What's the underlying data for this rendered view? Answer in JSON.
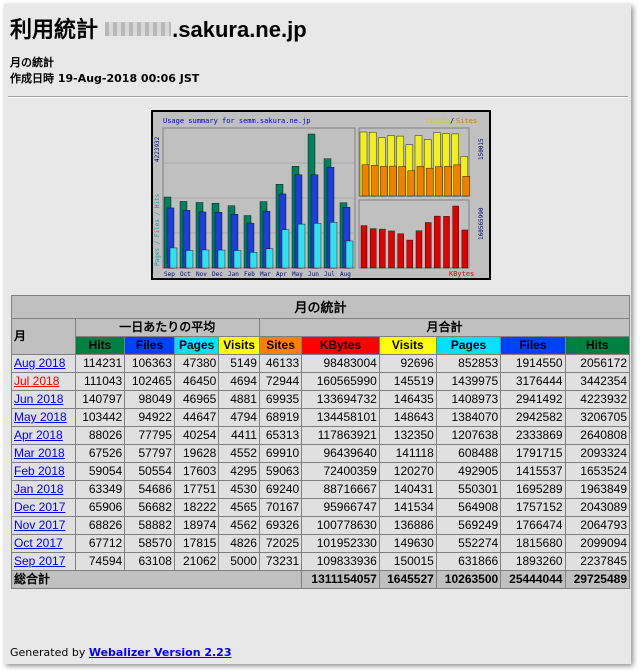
{
  "page": {
    "title_prefix": "利用統計",
    "title_suffix": ".sakura.ne.jp",
    "subtitle": "月の統計",
    "generated_line": "作成日時 19-Aug-2018 00:06 JST"
  },
  "chart_data": {
    "type": "bar",
    "title": "Usage summary for semm.sakura.ne.jp",
    "categories": [
      "Sep",
      "Oct",
      "Nov",
      "Dec",
      "Jan",
      "Feb",
      "Mar",
      "Apr",
      "May",
      "Jun",
      "Jul",
      "Aug"
    ],
    "left_axis_label": "Pages / Files / Hits",
    "left_axis_max_label": "4223932",
    "right_top_legend": [
      "Visits",
      "/",
      "Sites"
    ],
    "right_top_max_label": "150015",
    "right_bottom_legend": "KBytes",
    "right_bottom_max_label": "160565990",
    "series": [
      {
        "name": "Hits",
        "color": "#00805a",
        "values": [
          2237845,
          2099094,
          2064793,
          2043089,
          1963849,
          1653524,
          2093324,
          2640808,
          3206705,
          4223932,
          3442354,
          2056172
        ]
      },
      {
        "name": "Files",
        "color": "#1e3ed8",
        "values": [
          1893260,
          1815680,
          1766474,
          1757152,
          1695289,
          1415537,
          1791715,
          2333869,
          2942582,
          2941492,
          3176444,
          1914550
        ]
      },
      {
        "name": "Pages",
        "color": "#30e0f0",
        "values": [
          631866,
          552274,
          569249,
          564908,
          550301,
          492905,
          608488,
          1207638,
          1384070,
          1408973,
          1439975,
          852853
        ]
      },
      {
        "name": "Visits",
        "color": "#f0f020",
        "values": [
          150015,
          149630,
          136886,
          141534,
          140431,
          120270,
          141118,
          132350,
          148643,
          146435,
          145519,
          92696
        ]
      },
      {
        "name": "Sites",
        "color": "#f08000",
        "values": [
          73231,
          72025,
          69326,
          70167,
          69240,
          59063,
          69910,
          65313,
          68919,
          69935,
          72944,
          46133
        ]
      },
      {
        "name": "KBytes",
        "color": "#e00000",
        "values": [
          109833936,
          101952330,
          100778630,
          95966747,
          88716667,
          72400359,
          96439640,
          117863921,
          134458101,
          133694732,
          160565990,
          98483004
        ]
      }
    ]
  },
  "table": {
    "caption": "月の統計",
    "month_header": "月",
    "daily_avg_header": "一日あたりの平均",
    "monthly_total_header": "月合計",
    "daily_cols": [
      {
        "label": "Hits",
        "color": "#008040",
        "text": "#000000"
      },
      {
        "label": "Files",
        "color": "#0040ff",
        "text": "#000000"
      },
      {
        "label": "Pages",
        "color": "#00e0ff",
        "text": "#000000"
      },
      {
        "label": "Visits",
        "color": "#ffff00",
        "text": "#000000"
      }
    ],
    "total_cols": [
      {
        "label": "Sites",
        "color": "#ff8000",
        "text": "#000000"
      },
      {
        "label": "KBytes",
        "color": "#ff0000",
        "text": "#000000"
      },
      {
        "label": "Visits",
        "color": "#ffff00",
        "text": "#000000"
      },
      {
        "label": "Pages",
        "color": "#00e0ff",
        "text": "#000000"
      },
      {
        "label": "Files",
        "color": "#0040ff",
        "text": "#000000"
      },
      {
        "label": "Hits",
        "color": "#008040",
        "text": "#000000"
      }
    ],
    "rows": [
      {
        "month": "Aug 2018",
        "current": false,
        "vals": [
          "114231",
          "106363",
          "47380",
          "5149",
          "46133",
          "98483004",
          "92696",
          "852853",
          "1914550",
          "2056172"
        ]
      },
      {
        "month": "Jul 2018",
        "current": true,
        "vals": [
          "111043",
          "102465",
          "46450",
          "4694",
          "72944",
          "160565990",
          "145519",
          "1439975",
          "3176444",
          "3442354"
        ]
      },
      {
        "month": "Jun 2018",
        "current": false,
        "vals": [
          "140797",
          "98049",
          "46965",
          "4881",
          "69935",
          "133694732",
          "146435",
          "1408973",
          "2941492",
          "4223932"
        ]
      },
      {
        "month": "May 2018",
        "current": false,
        "vals": [
          "103442",
          "94922",
          "44647",
          "4794",
          "68919",
          "134458101",
          "148643",
          "1384070",
          "2942582",
          "3206705"
        ]
      },
      {
        "month": "Apr 2018",
        "current": false,
        "vals": [
          "88026",
          "77795",
          "40254",
          "4411",
          "65313",
          "117863921",
          "132350",
          "1207638",
          "2333869",
          "2640808"
        ]
      },
      {
        "month": "Mar 2018",
        "current": false,
        "vals": [
          "67526",
          "57797",
          "19628",
          "4552",
          "69910",
          "96439640",
          "141118",
          "608488",
          "1791715",
          "2093324"
        ]
      },
      {
        "month": "Feb 2018",
        "current": false,
        "vals": [
          "59054",
          "50554",
          "17603",
          "4295",
          "59063",
          "72400359",
          "120270",
          "492905",
          "1415537",
          "1653524"
        ]
      },
      {
        "month": "Jan 2018",
        "current": false,
        "vals": [
          "63349",
          "54686",
          "17751",
          "4530",
          "69240",
          "88716667",
          "140431",
          "550301",
          "1695289",
          "1963849"
        ]
      },
      {
        "month": "Dec 2017",
        "current": false,
        "vals": [
          "65906",
          "56682",
          "18222",
          "4565",
          "70167",
          "95966747",
          "141534",
          "564908",
          "1757152",
          "2043089"
        ]
      },
      {
        "month": "Nov 2017",
        "current": false,
        "vals": [
          "68826",
          "58882",
          "18974",
          "4562",
          "69326",
          "100778630",
          "136886",
          "569249",
          "1766474",
          "2064793"
        ]
      },
      {
        "month": "Oct 2017",
        "current": false,
        "vals": [
          "67712",
          "58570",
          "17815",
          "4826",
          "72025",
          "101952330",
          "149630",
          "552274",
          "1815680",
          "2099094"
        ]
      },
      {
        "month": "Sep 2017",
        "current": false,
        "vals": [
          "74594",
          "63108",
          "21062",
          "5000",
          "73231",
          "109833936",
          "150015",
          "631866",
          "1893260",
          "2237845"
        ]
      }
    ],
    "total_label": "総合計",
    "totals": [
      "1311154057",
      "1645527",
      "10263500",
      "25444044",
      "29725489"
    ]
  },
  "footer": {
    "generated_by": "Generated by",
    "link_text": "Webalizer Version 2.23"
  }
}
